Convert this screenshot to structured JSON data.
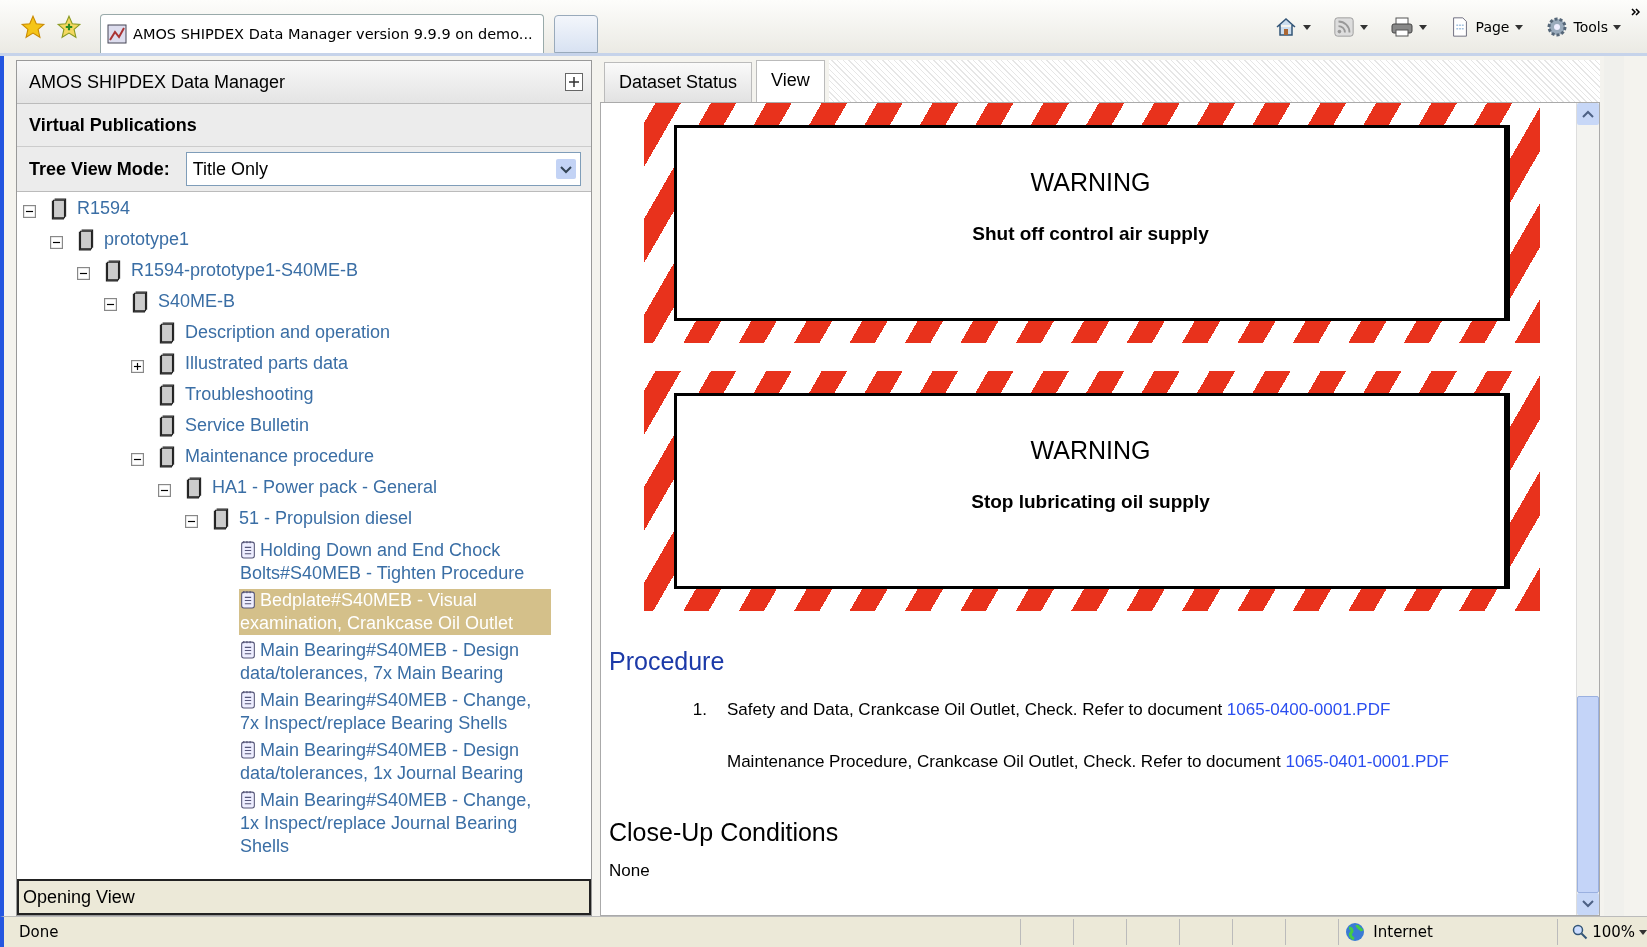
{
  "browser": {
    "tab_title": "AMOS SHIPDEX Data Manager version 9.9.9 on demo...",
    "commands": [
      {
        "kind": "home"
      },
      {
        "kind": "feeds"
      },
      {
        "kind": "print"
      },
      {
        "kind": "page",
        "label": "Page"
      },
      {
        "kind": "tools",
        "label": "Tools"
      }
    ]
  },
  "left_panel": {
    "title": "AMOS SHIPDEX Data Manager",
    "section": "Virtual Publications",
    "mode_label": "Tree View Mode:",
    "mode_value": "Title Only",
    "footer": "Opening View"
  },
  "tree": [
    {
      "label": "R1594",
      "kind": "book",
      "expanded": true,
      "selected": false,
      "children": [
        {
          "label": "prototype1",
          "kind": "book",
          "expanded": true,
          "selected": false,
          "children": [
            {
              "label": "R1594-prototype1-S40ME-B",
              "kind": "book",
              "expanded": true,
              "selected": false,
              "children": [
                {
                  "label": "S40ME-B",
                  "kind": "book",
                  "expanded": true,
                  "selected": false,
                  "children": [
                    {
                      "label": "Description and operation",
                      "kind": "book",
                      "selected": false
                    },
                    {
                      "label": "Illustrated parts data",
                      "kind": "book",
                      "expanded": false,
                      "selected": false
                    },
                    {
                      "label": "Troubleshooting",
                      "kind": "book",
                      "selected": false
                    },
                    {
                      "label": "Service Bulletin",
                      "kind": "book",
                      "selected": false
                    },
                    {
                      "label": "Maintenance procedure",
                      "kind": "book",
                      "expanded": true,
                      "selected": false,
                      "children": [
                        {
                          "label": "HA1 - Power pack - General",
                          "kind": "book",
                          "expanded": true,
                          "selected": false,
                          "children": [
                            {
                              "label": "51 - Propulsion diesel",
                              "kind": "book",
                              "expanded": true,
                              "selected": false,
                              "children": [
                                {
                                  "label": "Holding Down and End Chock Bolts#S40MEB - Tighten Procedure",
                                  "kind": "page",
                                  "selected": false
                                },
                                {
                                  "label": "Bedplate#S40MEB - Visual examination, Crankcase Oil Outlet",
                                  "kind": "page",
                                  "selected": true
                                },
                                {
                                  "label": "Main Bearing#S40MEB - Design data/tolerances, 7x Main Bearing",
                                  "kind": "page",
                                  "selected": false
                                },
                                {
                                  "label": "Main Bearing#S40MEB - Change, 7x Inspect/replace Bearing Shells",
                                  "kind": "page",
                                  "selected": false
                                },
                                {
                                  "label": "Main Bearing#S40MEB - Design data/tolerances, 1x Journal Bearing",
                                  "kind": "page",
                                  "selected": false
                                },
                                {
                                  "label": "Main Bearing#S40MEB - Change, 1x Inspect/replace Journal Bearing Shells",
                                  "kind": "page",
                                  "selected": false
                                }
                              ]
                            }
                          ]
                        }
                      ]
                    }
                  ]
                }
              ]
            }
          ]
        }
      ]
    }
  ],
  "tabs": [
    {
      "label": "Dataset Status",
      "selected": false
    },
    {
      "label": "View",
      "selected": true
    }
  ],
  "warnings": [
    {
      "title": "WARNING",
      "message": "Shut off control air supply"
    },
    {
      "title": "WARNING",
      "message": "Stop lubricating oil supply"
    }
  ],
  "procedure": {
    "heading": "Procedure",
    "steps": [
      {
        "number": "1.",
        "text": "Safety and Data, Crankcase Oil Outlet, Check. Refer to document ",
        "link": "1065-0400-0001.PDF"
      },
      {
        "text": "Maintenance Procedure, Crankcase Oil Outlet, Check. Refer to document ",
        "link": "1065-0401-0001.PDF"
      }
    ]
  },
  "close_up": {
    "heading": "Close-Up Conditions",
    "text": "None"
  },
  "status_bar": {
    "text": "Done",
    "zone": "Internet",
    "zoom": "100%"
  }
}
